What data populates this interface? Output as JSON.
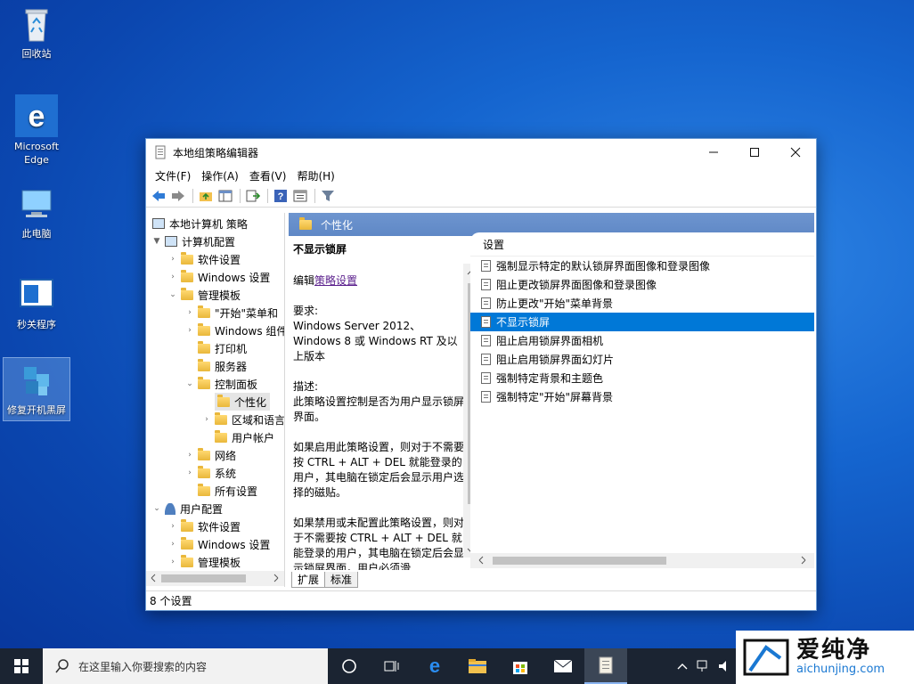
{
  "desktop": {
    "icons": [
      {
        "label": "回收站"
      },
      {
        "label": "Microsoft Edge"
      },
      {
        "label": "此电脑"
      },
      {
        "label": "秒关程序"
      },
      {
        "label": "修复开机黑屏"
      }
    ]
  },
  "window": {
    "title": "本地组策略编辑器",
    "menu": [
      "文件(F)",
      "操作(A)",
      "查看(V)",
      "帮助(H)"
    ],
    "tree": [
      {
        "label": "本地计算机 策略",
        "level": 0,
        "icon": "pc-icon"
      },
      {
        "label": "计算机配置",
        "level": 1,
        "icon": "pc-icon"
      },
      {
        "label": "软件设置",
        "level": 2
      },
      {
        "label": "Windows 设置",
        "level": 2
      },
      {
        "label": "管理模板",
        "level": 2
      },
      {
        "label": "\"开始\"菜单和",
        "level": 3
      },
      {
        "label": "Windows 组件",
        "level": 3
      },
      {
        "label": "打印机",
        "level": 3
      },
      {
        "label": "服务器",
        "level": 3
      },
      {
        "label": "控制面板",
        "level": 3
      },
      {
        "label": "个性化",
        "level": 4
      },
      {
        "label": "区域和语言",
        "level": 4
      },
      {
        "label": "用户帐户",
        "level": 4
      },
      {
        "label": "网络",
        "level": 3
      },
      {
        "label": "系统",
        "level": 3
      },
      {
        "label": "所有设置",
        "level": 3
      },
      {
        "label": "用户配置",
        "level": 1,
        "icon": "user-icon"
      },
      {
        "label": "软件设置",
        "level": 2
      },
      {
        "label": "Windows 设置",
        "level": 2
      },
      {
        "label": "管理模板",
        "level": 2
      }
    ],
    "header_title": "个性化",
    "desc": {
      "title": "不显示锁屏",
      "edit_prefix": "编辑",
      "edit_link": "策略设置",
      "req_label": "要求:",
      "req_text": "Windows Server 2012、Windows 8 或 Windows RT 及以上版本",
      "desc_label": "描述:",
      "desc_text": "此策略设置控制是否为用户显示锁屏界面。",
      "p1": "如果启用此策略设置，则对于不需要按 CTRL + ALT + DEL 就能登录的用户，其电脑在锁定后会显示用户选择的磁贴。",
      "p2": "如果禁用或未配置此策略设置，则对于不需要按 CTRL + ALT + DEL 就能登录的用户，其电脑在锁定后会显示锁屏界面，用户必须滑"
    },
    "list_header": "设置",
    "list": [
      "强制显示特定的默认锁屏界面图像和登录图像",
      "阻止更改锁屏界面图像和登录图像",
      "防止更改\"开始\"菜单背景",
      "不显示锁屏",
      "阻止启用锁屏界面相机",
      "阻止启用锁屏界面幻灯片",
      "强制特定背景和主题色",
      "强制特定\"开始\"屏幕背景"
    ],
    "selected_index": 3,
    "tabs": [
      "扩展",
      "标准"
    ],
    "status": "8 个设置"
  },
  "taskbar": {
    "search_placeholder": "在这里输入你要搜索的内容"
  },
  "watermark": {
    "cn": "爱纯净",
    "en": "aichunjing.com"
  }
}
